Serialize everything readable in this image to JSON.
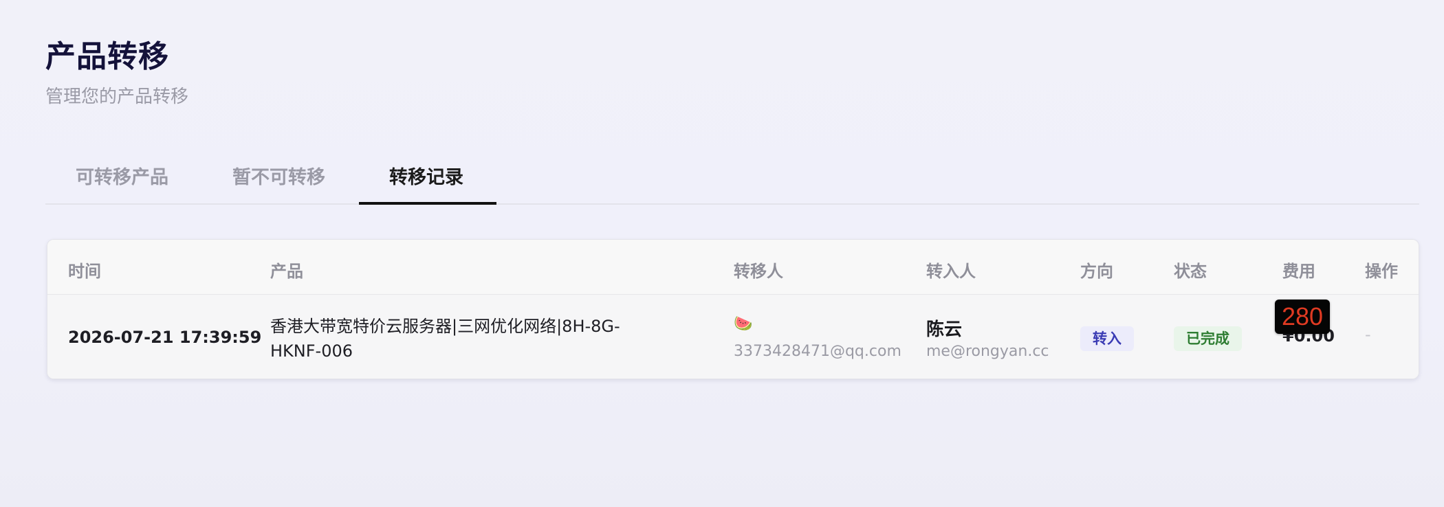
{
  "header": {
    "title": "产品转移",
    "subtitle": "管理您的产品转移"
  },
  "tabs": [
    {
      "label": "可转移产品",
      "active": false
    },
    {
      "label": "暂不可转移",
      "active": false
    },
    {
      "label": "转移记录",
      "active": true
    }
  ],
  "table": {
    "columns": [
      "时间",
      "产品",
      "转移人",
      "转入人",
      "方向",
      "状态",
      "费用",
      "操作"
    ],
    "rows": [
      {
        "time": "2026-07-21 17:39:59",
        "product": "香港大带宽特价云服务器|三网优化网络|8H-8G-HKNF-006",
        "from_emoji": "🍉",
        "from_email": "3373428471@qq.com",
        "to_name": "陈云",
        "to_email": "me@rongyan.cc",
        "direction": "转入",
        "status": "已完成",
        "fee": "¥0.00",
        "action": "-"
      }
    ]
  },
  "tooltip": {
    "value": "280"
  },
  "colors": {
    "accent_text": "#14123a",
    "direction_badge_bg": "#ececfb",
    "direction_badge_text": "#3a3bb4",
    "status_badge_bg": "#e9f5ea",
    "status_badge_text": "#2e7d32",
    "tooltip_bg": "#050505",
    "tooltip_text": "#e03a22"
  }
}
